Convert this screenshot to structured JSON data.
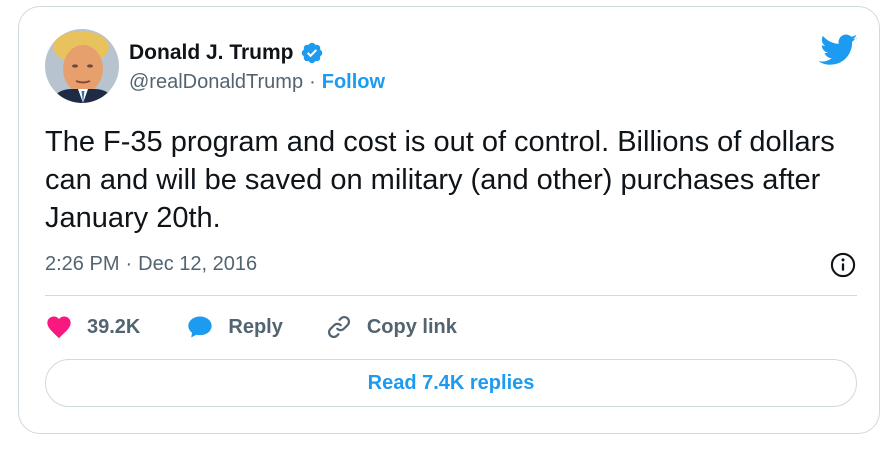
{
  "author": {
    "display_name": "Donald J. Trump",
    "handle": "@realDonaldTrump",
    "separator": "·",
    "follow_label": "Follow"
  },
  "tweet": {
    "text": "The F-35 program and cost is out of control. Billions of dollars can and will be saved on military (and other) purchases after January 20th.",
    "time": "2:26 PM",
    "separator": "·",
    "date": "Dec 12, 2016"
  },
  "actions": {
    "likes_count": "39.2K",
    "reply_label": "Reply",
    "copy_link_label": "Copy link"
  },
  "read_replies_label": "Read 7.4K replies",
  "colors": {
    "accent": "#1d9bf0",
    "like": "#f91880",
    "text_primary": "#0f1419",
    "text_secondary": "#536471",
    "border": "#cfd9de"
  },
  "icons": {
    "avatar": "avatar",
    "verified": "verified-badge-icon",
    "brand": "twitter-bird-icon",
    "info": "info-icon",
    "like": "heart-icon",
    "reply": "speech-bubble-icon",
    "copy_link": "link-icon"
  }
}
